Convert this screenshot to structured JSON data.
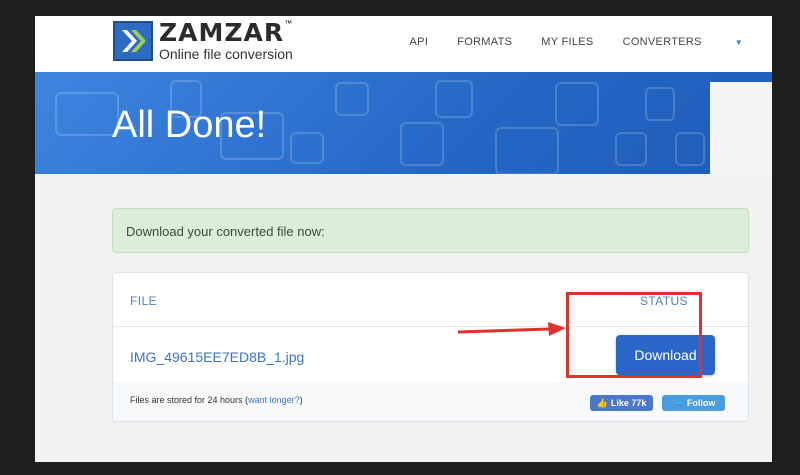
{
  "app": {
    "brand": "ZAMZAR",
    "trademark": "™",
    "tagline": "Online file conversion"
  },
  "nav": {
    "items": [
      "API",
      "FORMATS",
      "MY FILES",
      "CONVERTERS"
    ]
  },
  "banner": {
    "title": "All Done!"
  },
  "alert": {
    "message": "Download your converted file now:"
  },
  "table": {
    "columns": [
      "FILE",
      "STATUS"
    ],
    "rows": [
      {
        "file": "IMG_49615EE7ED8B_1.jpg",
        "action": "Download"
      }
    ]
  },
  "footer": {
    "storage_note": "Files are stored for 24 hours (",
    "want_longer": "want longer?",
    "storage_close": ")",
    "like_label": "Like 77k",
    "follow_label": "Follow"
  },
  "annotation": {
    "highlight_color": "#e0322c"
  },
  "colors": {
    "accent": "#2a66c8",
    "banner": "#2e73d0",
    "alert_bg": "#dbeed9"
  }
}
